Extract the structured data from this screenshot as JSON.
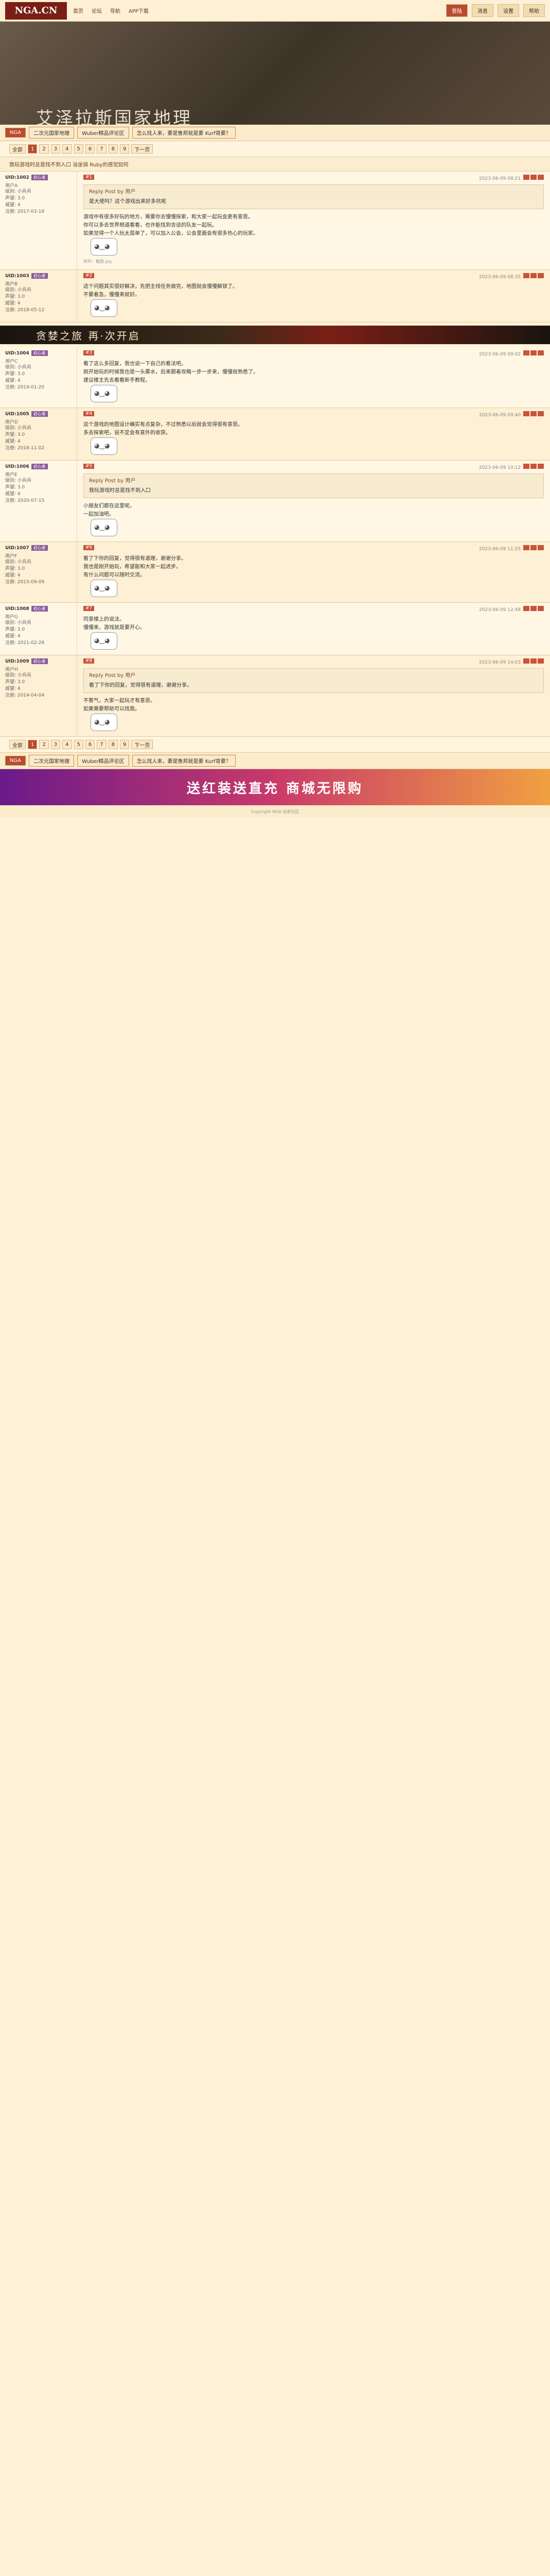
{
  "site": {
    "logo": "NGA.CN",
    "nav": [
      "首页",
      "论坛",
      "导航",
      "APP下载"
    ],
    "right": [
      "登陆",
      "消息",
      "设置",
      "帮助"
    ]
  },
  "banner": {
    "title": "艾泽拉斯国家地理"
  },
  "forum_tabs": [
    "NGA",
    "二次元国家地理",
    "Wuber精品评论区",
    "怎么找人来，要是鲁邦就是要 Kurf哥要？"
  ],
  "pager": [
    "全部",
    "1",
    "2",
    "3",
    "4",
    "5",
    "6",
    "7",
    "8",
    "9",
    "下一页"
  ],
  "thread": {
    "title": "我玩游戏时总是找不到入口 当坐骑 Ruby的感觉如何"
  },
  "posts": [
    {
      "floor": "#1",
      "user": "UID:1002",
      "name": "用户A",
      "tag": "初心者",
      "meta": [
        "级别: 小兵兵",
        "声望: 3.0",
        "威望: 4",
        "注册: 2017-03-18"
      ],
      "time": "2023-06-09 08:21",
      "quote_head": "Reply Post by 用户",
      "quote": "是大佬吗？这个游戏出来好多坑呢",
      "text": "游戏中有很多好玩的地方，需要你去慢慢探索，和大家一起玩会更有意思。\n你可以多去世界频道看看，也许能找到合适的队友一起玩。\n如果觉得一个人玩太孤单了，可以加入公会，公会里面会有很多热心的玩家。",
      "sig": "附件：截图.jpg"
    },
    {
      "floor": "#2",
      "user": "UID:1003",
      "name": "用户B",
      "tag": "初心者",
      "meta": [
        "级别: 小兵兵",
        "声望: 3.0",
        "威望: 4",
        "注册: 2018-05-12"
      ],
      "time": "2023-06-09 08:35",
      "quote_head": "",
      "quote": "",
      "text": "这个问题其实很好解决，先把主线任务做完，地图就会慢慢解锁了。\n不要着急，慢慢来就好。",
      "sig": ""
    },
    {
      "floor": "#3",
      "user": "UID:1004",
      "name": "用户C",
      "tag": "初心者",
      "meta": [
        "级别: 小兵兵",
        "声望: 3.0",
        "威望: 4",
        "注册: 2019-01-20"
      ],
      "time": "2023-06-09 09:02",
      "quote_head": "",
      "quote": "",
      "text": "看了这么多回复，我也说一下自己的看法吧。\n刚开始玩的时候我也是一头雾水，后来跟着攻略一步一步来，慢慢就熟悉了。\n建议楼主先去看看新手教程。",
      "sig": ""
    },
    {
      "floor": "#4",
      "user": "UID:1005",
      "name": "用户D",
      "tag": "初心者",
      "meta": [
        "级别: 小兵兵",
        "声望: 3.0",
        "威望: 4",
        "注册: 2016-11-02"
      ],
      "time": "2023-06-09 09:40",
      "quote_head": "",
      "quote": "",
      "text": "这个游戏的地图设计确实有点复杂，不过熟悉以后就会觉得很有意思。\n多去探索吧，说不定会有意外的收获。",
      "sig": ""
    },
    {
      "floor": "#5",
      "user": "UID:1006",
      "name": "用户E",
      "tag": "初心者",
      "meta": [
        "级别: 小兵兵",
        "声望: 3.0",
        "威望: 4",
        "注册: 2020-07-15"
      ],
      "time": "2023-06-09 10:12",
      "quote_head": "Reply Post by 用户",
      "quote": "我玩游戏时总是找不到入口",
      "text": "小朋友们都在这里呢。\n一起加油吧。",
      "sig": ""
    },
    {
      "floor": "#6",
      "user": "UID:1007",
      "name": "用户F",
      "tag": "初心者",
      "meta": [
        "级别: 小兵兵",
        "声望: 3.0",
        "威望: 4",
        "注册: 2015-09-09"
      ],
      "time": "2023-06-09 11:25",
      "quote_head": "",
      "quote": "",
      "text": "看了下你的回复，觉得很有道理，谢谢分享。\n我也是刚开始玩，希望能和大家一起进步。\n有什么问题可以随时交流。",
      "sig": ""
    },
    {
      "floor": "#7",
      "user": "UID:1008",
      "name": "用户G",
      "tag": "初心者",
      "meta": [
        "级别: 小兵兵",
        "声望: 3.0",
        "威望: 4",
        "注册: 2021-02-28"
      ],
      "time": "2023-06-09 12:48",
      "quote_head": "",
      "quote": "",
      "text": "同意楼上的说法。\n慢慢来，游戏就是要开心。",
      "sig": ""
    },
    {
      "floor": "#8",
      "user": "UID:1009",
      "name": "用户H",
      "tag": "初心者",
      "meta": [
        "级别: 小兵兵",
        "声望: 3.0",
        "威望: 4",
        "注册: 2014-04-04"
      ],
      "time": "2023-06-09 14:03",
      "quote_head": "Reply Post by 用户",
      "quote": "看了下你的回复，觉得很有道理，谢谢分享。",
      "text": "不客气，大家一起玩才有意思。\n如果需要帮助可以找我。",
      "sig": ""
    }
  ],
  "ad": {
    "mid": "贪婪之旅 再·次开启",
    "bottom": "送红装送直充 商城无限购"
  },
  "footer": "Copyright NGA 玩家社区"
}
